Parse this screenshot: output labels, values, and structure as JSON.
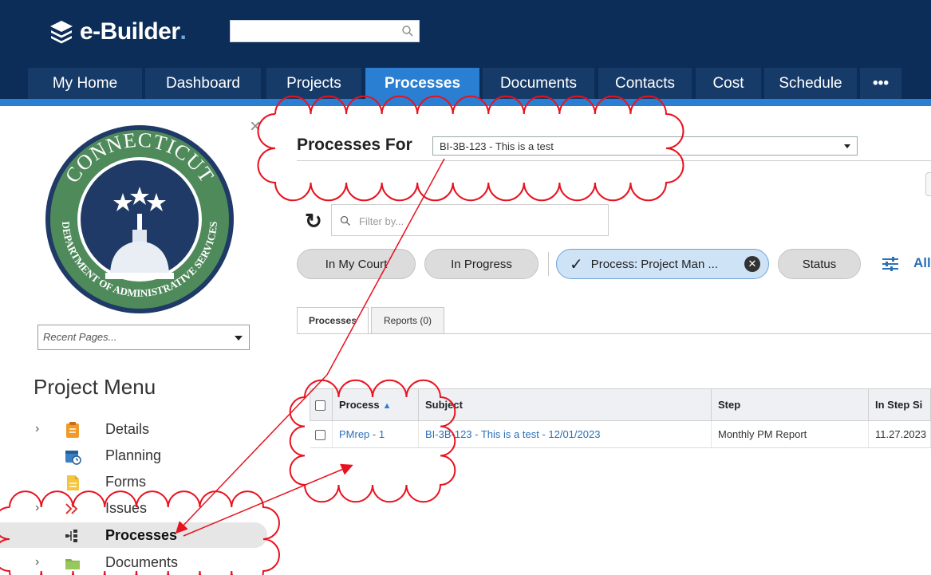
{
  "app": {
    "logo_text": "e-Builder",
    "logo_dot": "."
  },
  "search": {
    "placeholder": "",
    "value": ""
  },
  "nav": {
    "tabs": [
      {
        "label": "My Home"
      },
      {
        "label": "Dashboard"
      },
      {
        "label": "Projects"
      },
      {
        "label": "Processes",
        "active": true
      },
      {
        "label": "Documents"
      },
      {
        "label": "Contacts"
      },
      {
        "label": "Cost"
      },
      {
        "label": "Schedule"
      },
      {
        "label": "•••"
      }
    ]
  },
  "sidebar": {
    "close": "×",
    "seal": {
      "top_text": "CONNECTICUT",
      "bottom_text": "DEPARTMENT OF ADMINISTRATIVE SERVICES",
      "colors": {
        "ring": "#4f8a5b",
        "center": "#1f3a66",
        "accent": "#ffffff"
      }
    },
    "recent_pages": {
      "value": "Recent Pages..."
    },
    "menu_title": "Project Menu",
    "items": [
      {
        "label": "Details",
        "icon": "clipboard-icon",
        "expandable": true
      },
      {
        "label": "Planning",
        "icon": "calendar-clock-icon",
        "expandable": false
      },
      {
        "label": "Forms",
        "icon": "document-icon",
        "expandable": false
      },
      {
        "label": "Issues",
        "icon": "issues-icon",
        "expandable": true
      },
      {
        "label": "Processes",
        "icon": "process-flow-icon",
        "expandable": false,
        "active": true
      },
      {
        "label": "Documents",
        "icon": "folder-icon",
        "expandable": true
      }
    ]
  },
  "main": {
    "processes_for_label": "Processes For",
    "project_select": {
      "value": "BI-3B-123 - This is a test"
    },
    "filter": {
      "placeholder": "Filter by..."
    },
    "chips": [
      {
        "label": "In My Court"
      },
      {
        "label": "In Progress"
      },
      {
        "label": "Process: Project Man ...",
        "selected": true
      },
      {
        "label": "Status"
      }
    ],
    "all_label": "All",
    "tabs": [
      {
        "label": "Processes",
        "active": true
      },
      {
        "label": "Reports (0)"
      }
    ],
    "table": {
      "columns": [
        "",
        "Process",
        "Subject",
        "Step",
        "In Step Si"
      ],
      "rows": [
        {
          "process": "PMrep - 1",
          "subject": "BI-3B-123 - This is a test - 12/01/2023",
          "step": "Monthly PM Report",
          "in_step_since": "11.27.2023"
        }
      ]
    }
  },
  "colors": {
    "header_bg": "#0c2d57",
    "nav_active": "#2a7fd2",
    "link": "#2a6fb8",
    "annotation": "#e8121f"
  }
}
